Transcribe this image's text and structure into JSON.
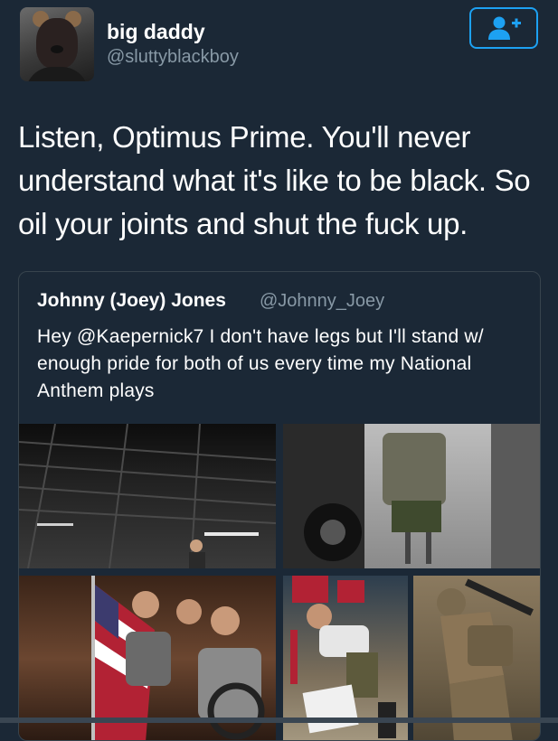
{
  "tweet": {
    "author_name": "big daddy",
    "author_handle": "@sluttyblackboy",
    "text": "Listen, Optimus Prime. You'll never understand what it's like to be black. So oil your joints and shut the fuck up."
  },
  "quoted_tweet": {
    "author_name": "Johnny (Joey) Jones",
    "author_handle": "@Johnny_Joey",
    "text": "Hey @Kaepernick7 I don't have legs but I'll stand w/ enough pride for both of us every time my National Anthem plays"
  },
  "icons": {
    "follow": "add-user-icon",
    "avatar": "user-avatar"
  },
  "colors": {
    "background": "#1b2836",
    "accent": "#1da1f2",
    "secondary_text": "#8899a6",
    "border": "#38444d"
  }
}
